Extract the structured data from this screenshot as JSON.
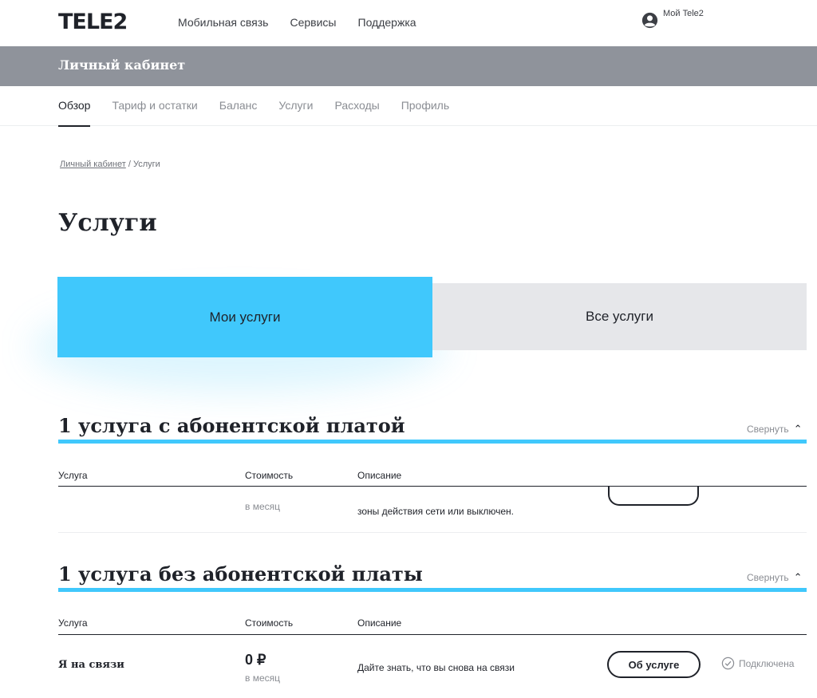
{
  "header": {
    "logo": "TELE2",
    "nav": [
      "Мобильная связь",
      "Сервисы",
      "Поддержка"
    ],
    "account_label": "Мой Tele2"
  },
  "cabinet_bar": {
    "title": "Личный кабинет"
  },
  "subnav": {
    "items": [
      "Обзор",
      "Тариф и остатки",
      "Баланс",
      "Услуги",
      "Расходы",
      "Профиль"
    ],
    "active": "Обзор"
  },
  "breadcrumb": {
    "parent": "Личный кабинет",
    "separator": " / ",
    "current": "Услуги"
  },
  "page_title": "Услуги",
  "tabs": {
    "my": "Мои услуги",
    "all": "Все услуги"
  },
  "sections": [
    {
      "title": "1 услуга с абонентской платой",
      "collapse_label": "Свернуть",
      "columns": [
        "Услуга",
        "Стоимость",
        "Описание"
      ],
      "row": {
        "per": "в месяц",
        "description": "зоны действия сети или выключен."
      }
    },
    {
      "title": "1 услуга без абонентской платы",
      "collapse_label": "Свернуть",
      "columns": [
        "Услуга",
        "Стоимость",
        "Описание"
      ],
      "row": {
        "name": "Я на связи",
        "price": "0 ₽",
        "per": "в месяц",
        "description": "Дайте знать, что вы снова на связи",
        "button": "Об услуге",
        "status": "Подключена"
      }
    }
  ],
  "colors": {
    "accent": "#40c8fc",
    "graybar": "#8f939b",
    "text": "#1f2229",
    "muted": "#8a8d93",
    "tab_inactive": "#e6e7ea"
  }
}
